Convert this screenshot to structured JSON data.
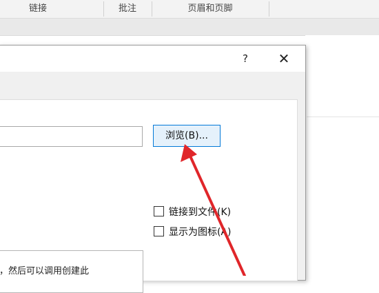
{
  "ribbon": {
    "groups": [
      "链接",
      "批注",
      "页眉和页脚"
    ]
  },
  "dialog": {
    "help_label": "?",
    "close_label": "✕",
    "file_name_value": "",
    "browse_label": "浏览(B)...",
    "link_to_file_label": "链接到文件(K)",
    "display_as_icon_label": "显示为图标(A)",
    "result_text": "，然后可以调用创建此"
  },
  "annotation": {
    "arrow_color": "#e0262a"
  }
}
